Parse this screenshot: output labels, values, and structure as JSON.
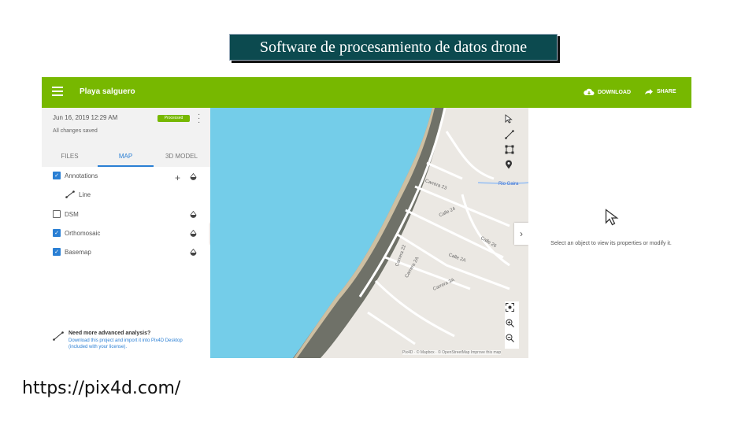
{
  "slide": {
    "title": "Software de procesamiento de datos drone",
    "url": "https://pix4d.com/"
  },
  "app": {
    "project_name": "Playa salguero",
    "actions": {
      "download": "DOWNLOAD",
      "share": "SHARE"
    },
    "project": {
      "date": "Jun 16, 2019 12:29 AM",
      "status_badge": "Processed",
      "save_status": "All changes saved"
    },
    "tabs": [
      {
        "label": "FILES",
        "active": false
      },
      {
        "label": "MAP",
        "active": true
      },
      {
        "label": "3D MODEL",
        "active": false
      }
    ],
    "layers": {
      "annotations": {
        "label": "Annotations",
        "checked": true
      },
      "line": {
        "label": "Line"
      },
      "dsm": {
        "label": "DSM",
        "checked": false
      },
      "orthomosaic": {
        "label": "Orthomosaic",
        "checked": true
      },
      "basemap": {
        "label": "Basemap",
        "checked": true
      }
    },
    "help": {
      "title": "Need more advanced analysis?",
      "text": "Download this project and import it into Pix4D Desktop (included with your license)."
    },
    "map": {
      "street_labels": [
        "Carrera 23",
        "Carrera 22",
        "Carrera 2A",
        "Carrera 3A",
        "Calle 26",
        "Calle 2A",
        "Calle 24"
      ],
      "river_label": "Rio Gaira",
      "attribution": "Pix4D · © Mapbox · © OpenStreetMap Improve this map",
      "colors": {
        "water": "#74cde9",
        "land": "#ebe8e3",
        "road": "#ffffff",
        "orthomosaic": "#6f7168"
      }
    },
    "properties_hint": "Select an object to view its properties or modify it.",
    "colors": {
      "topbar": "#77b800",
      "accent": "#2a7fd4"
    }
  }
}
